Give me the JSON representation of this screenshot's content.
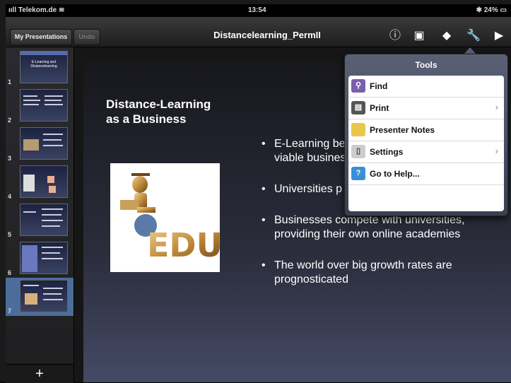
{
  "status_bar": {
    "carrier": "Telekom.de",
    "time": "13:54",
    "battery": "24%"
  },
  "toolbar": {
    "my_presentations": "My Presentations",
    "undo": "Undo",
    "title": "Distancelearning_PermII",
    "icons": [
      "info-icon",
      "media-icon",
      "animation-icon",
      "tools-icon",
      "play-icon"
    ]
  },
  "sidebar": {
    "slides": [
      {
        "number": "1",
        "thumb_text": "E-Learning and Distancelearning"
      },
      {
        "number": "2"
      },
      {
        "number": "3"
      },
      {
        "number": "4"
      },
      {
        "number": "5"
      },
      {
        "number": "6"
      },
      {
        "number": "7",
        "selected": true
      }
    ],
    "add_label": "+"
  },
  "slide": {
    "title": "Distance-Learning\nas a Business",
    "bullets": [
      "E-Learning be\nviable busines",
      "Universities p",
      "Businesses compete with universities,\nproviding their own online academies",
      "The world over big growth rates are\nprognosticated"
    ]
  },
  "tools_popover": {
    "title": "Tools",
    "items": [
      {
        "label": "Find",
        "icon": "magnifier-icon",
        "chevron": false,
        "color": "#7a5fb0"
      },
      {
        "label": "Print",
        "icon": "printer-icon",
        "chevron": true,
        "color": "#555555"
      },
      {
        "label": "Presenter Notes",
        "icon": "notes-icon",
        "chevron": false,
        "color": "#e8c84a"
      },
      {
        "label": "Settings",
        "icon": "settings-icon",
        "chevron": true,
        "color": "#cccccc"
      },
      {
        "label": "Go to Help...",
        "icon": "help-icon",
        "chevron": false,
        "color": "#3a8fd8"
      }
    ]
  }
}
